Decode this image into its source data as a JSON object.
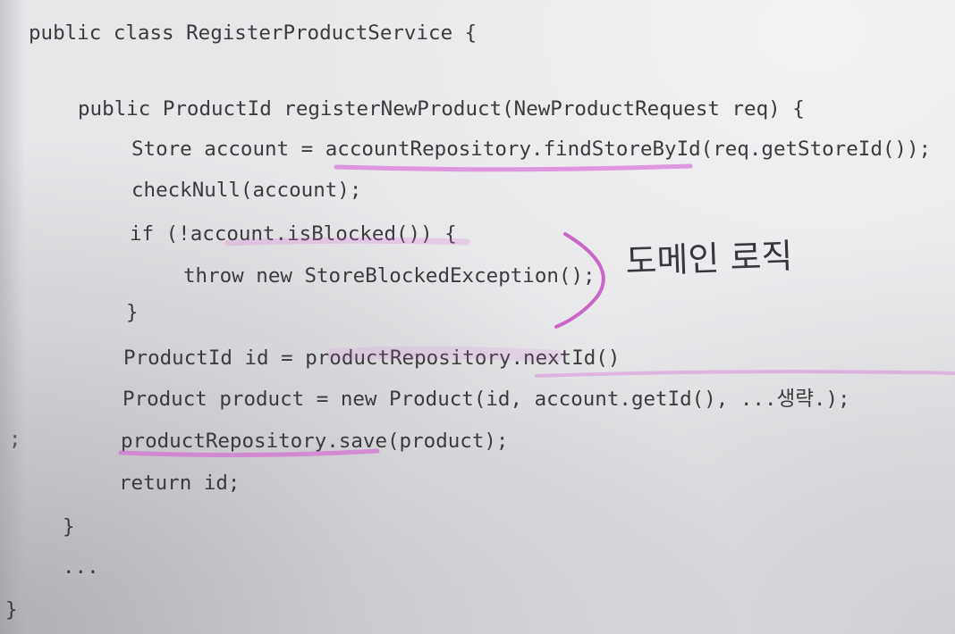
{
  "page": {
    "background": "#e7e7ea",
    "text_color": "#3b3b3e",
    "highlight_color": "#d45fd0"
  },
  "code": {
    "lines": [
      "public class RegisterProductService {",
      "public ProductId registerNewProduct(NewProductRequest req) {",
      "Store account = accountRepository.findStoreById(req.getStoreId());",
      "checkNull(account);",
      "if (!account.isBlocked()) {",
      "throw new StoreBlockedException();",
      "}",
      "ProductId id = productRepository.nextId()",
      "Product product = new Product(id, account.getId(), ...생략.);",
      "productRepository.save(product);",
      "return id;",
      "}",
      "...",
      "}"
    ]
  },
  "margin_mark": ";",
  "annotation": {
    "handwritten_note": "도메인 로직"
  }
}
